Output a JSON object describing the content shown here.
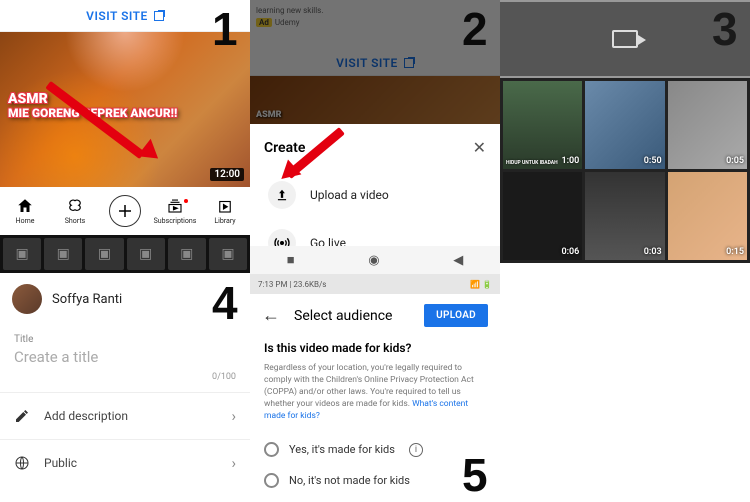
{
  "step_numbers": [
    "1",
    "2",
    "3",
    "4",
    "5"
  ],
  "panel1": {
    "visit_site": "VISIT SITE",
    "thumb_line1": "ASMR",
    "thumb_line2": "MIE GORENG GEPREK ANCUR!!",
    "duration": "12:00",
    "nav": {
      "home": "Home",
      "shorts": "Shorts",
      "subscriptions": "Subscriptions",
      "library": "Library"
    }
  },
  "panel2": {
    "ad_text": "learning new skills.",
    "ad_brand": "Udemy",
    "ad_badge": "Ad",
    "visit_site": "VISIT SITE",
    "sheet_title": "Create",
    "upload": "Upload a video",
    "golive": "Go live"
  },
  "panel3": {
    "cells": [
      {
        "overlay": "HIDUP UNTUK IBADAH",
        "dur": "1:00"
      },
      {
        "overlay": "",
        "dur": "0:50"
      },
      {
        "overlay": "",
        "dur": "0:05"
      },
      {
        "overlay": "",
        "dur": "0:06"
      },
      {
        "overlay": "",
        "dur": "0:03"
      },
      {
        "overlay": "",
        "dur": "0:15"
      }
    ]
  },
  "panel4": {
    "user": "Soffya Ranti",
    "title_label": "Title",
    "title_placeholder": "Create a title",
    "counter": "0/100",
    "description": "Add description",
    "visibility": "Public"
  },
  "panel5": {
    "status_left": "7:13 PM | 23.6KB/s",
    "header_title": "Select audience",
    "upload_btn": "UPLOAD",
    "question": "Is this video made for kids?",
    "legal": "Regardless of your location, you're legally required to comply with the Children's Online Privacy Protection Act (COPPA) and/or other laws. You're required to tell us whether your videos are made for kids. ",
    "legal_link": "What's content made for kids?",
    "opt_yes": "Yes, it's made for kids",
    "opt_no": "No, it's not made for kids"
  }
}
